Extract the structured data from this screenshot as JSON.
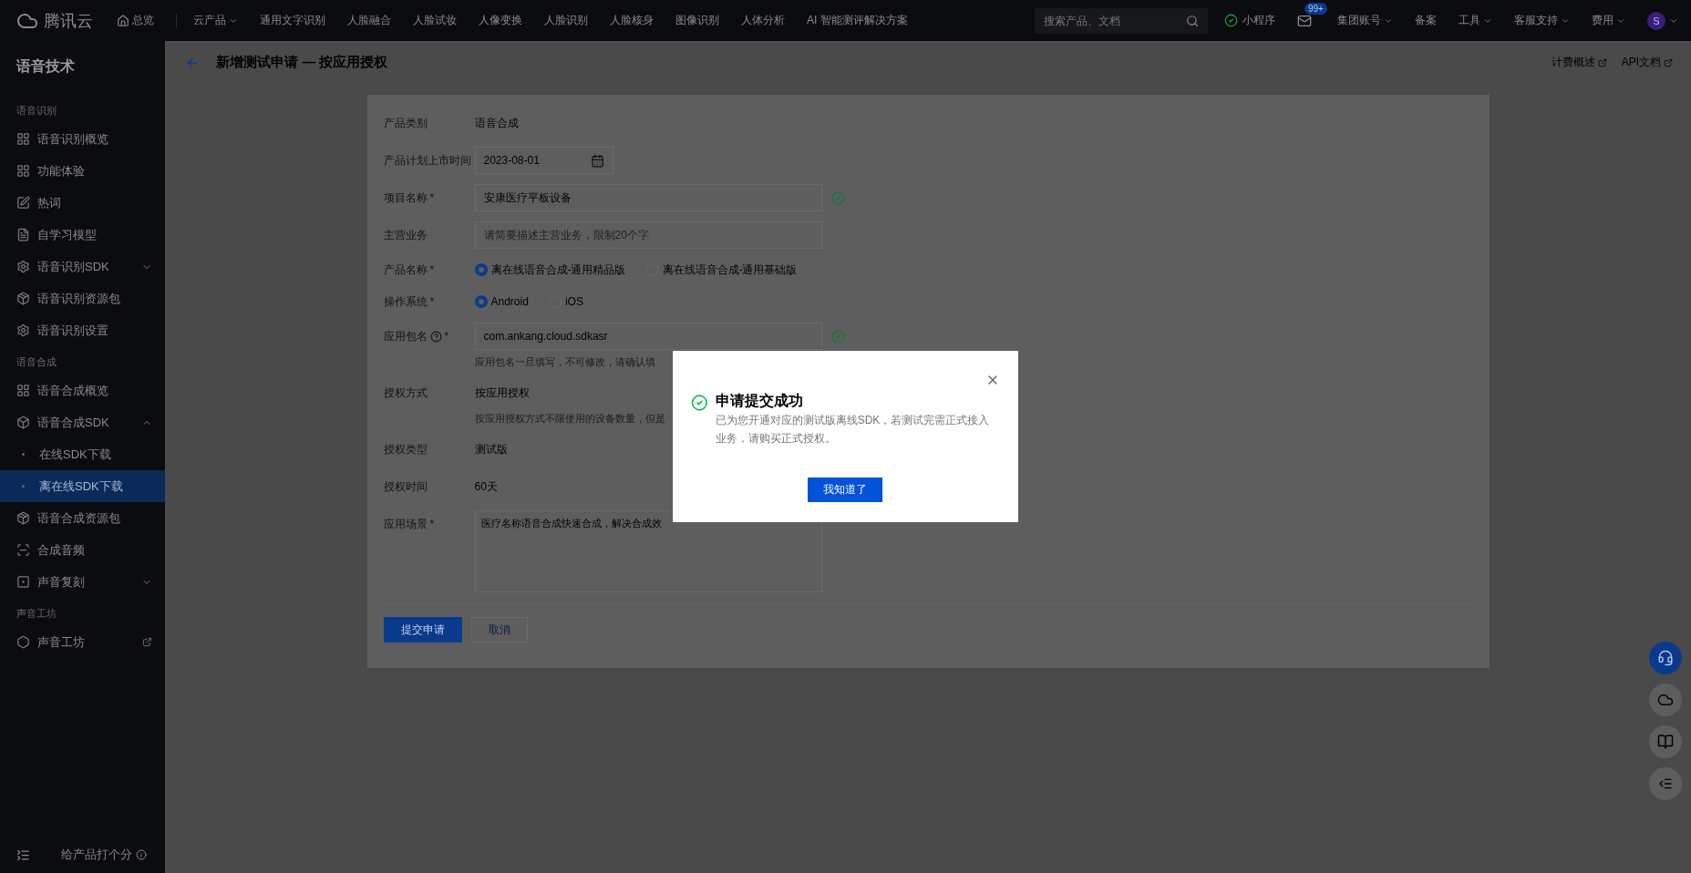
{
  "topbar": {
    "logo": "腾讯云",
    "home": "总览",
    "nav": [
      {
        "label": "云产品",
        "dropdown": true
      },
      {
        "label": "通用文字识别",
        "dropdown": false
      },
      {
        "label": "人脸融合",
        "dropdown": false
      },
      {
        "label": "人脸试妆",
        "dropdown": false
      },
      {
        "label": "人像变换",
        "dropdown": false
      },
      {
        "label": "人脸识别",
        "dropdown": false
      },
      {
        "label": "人脸核身",
        "dropdown": false
      },
      {
        "label": "图像识别",
        "dropdown": false
      },
      {
        "label": "人体分析",
        "dropdown": false
      },
      {
        "label": "AI 智能测评解决方案",
        "dropdown": false
      }
    ],
    "search": {
      "placeholder": "搜索产品、文档"
    },
    "miniapp": "小程序",
    "mail_badge": "99+",
    "right": [
      {
        "label": "集团账号",
        "dropdown": true
      },
      {
        "label": "备案",
        "dropdown": false
      },
      {
        "label": "工具",
        "dropdown": true
      },
      {
        "label": "客服支持",
        "dropdown": true
      },
      {
        "label": "费用",
        "dropdown": true
      }
    ],
    "avatar": "S"
  },
  "sidebar": {
    "title": "语音技术",
    "groups": [
      {
        "label": "语音识别",
        "items": [
          {
            "label": "语音识别概览",
            "selected": false
          },
          {
            "label": "功能体验",
            "selected": false
          },
          {
            "label": "热词",
            "selected": false
          },
          {
            "label": "自学习模型",
            "selected": false
          },
          {
            "label": "语音识别SDK",
            "selected": false,
            "expanded": false
          },
          {
            "label": "语音识别资源包",
            "selected": false
          },
          {
            "label": "语音识别设置",
            "selected": false
          }
        ]
      },
      {
        "label": "语音合成",
        "items": [
          {
            "label": "语音合成概览",
            "selected": false
          },
          {
            "label": "语音合成SDK",
            "selected": false,
            "expanded": true,
            "children": [
              {
                "label": "在线SDK下载",
                "selected": false
              },
              {
                "label": "离在线SDK下载",
                "selected": true
              }
            ]
          },
          {
            "label": "语音合成资源包",
            "selected": false
          },
          {
            "label": "合成音频",
            "selected": false
          },
          {
            "label": "声音复刻",
            "selected": false,
            "expanded": false
          }
        ]
      },
      {
        "label": "声音工坊",
        "items": [
          {
            "label": "声音工坊",
            "selected": false,
            "external": true
          }
        ]
      }
    ],
    "footer": "给产品打个分"
  },
  "header": {
    "title": "新增测试申请 — 按应用授权",
    "links": [
      "计费概述",
      "API文档"
    ]
  },
  "form": {
    "rows": [
      {
        "kind": "text",
        "label": "产品类别",
        "value": "语音合成"
      },
      {
        "kind": "date",
        "label": "产品计划上市时间",
        "value": "2023-08-01"
      },
      {
        "kind": "input",
        "label": "项目名称",
        "required_mark": "*",
        "value": "安康医疗平板设备",
        "valid": true
      },
      {
        "kind": "input",
        "label": "主营业务",
        "placeholder": "请简要描述主营业务，限制20个字",
        "valid": false
      },
      {
        "kind": "radio",
        "label": "产品名称",
        "required_mark": "*",
        "options": [
          {
            "label": "离在线语音合成-通用精品版",
            "selected": true
          },
          {
            "label": "离在线语音合成-通用基础版",
            "selected": false
          }
        ]
      },
      {
        "kind": "radio",
        "label": "操作系统",
        "required_mark": "*",
        "options": [
          {
            "label": "Android",
            "selected": true
          },
          {
            "label": "iOS",
            "selected": false
          }
        ]
      },
      {
        "kind": "input",
        "label": "应用包名",
        "help": true,
        "required_mark": "*",
        "value": "com.ankang.cloud.sdkasr",
        "valid": true,
        "hint": "应用包名一旦填写，不可修改，请确认填"
      },
      {
        "kind": "text",
        "label": "授权方式",
        "value": "按应用授权",
        "hint": "按应用授权方式不限使用的设备数量，但是"
      },
      {
        "kind": "text",
        "label": "授权类型",
        "value": "测试版"
      },
      {
        "kind": "text",
        "label": "授权时间",
        "value": "60天"
      },
      {
        "kind": "textarea",
        "label": "应用场景",
        "required_mark": "*",
        "value": "医疗名称语音合成快速合成，解决合成效"
      }
    ],
    "buttons": [
      {
        "label": "提交申请",
        "kind": "primary"
      },
      {
        "label": "取消",
        "kind": "secondary"
      }
    ]
  },
  "dialog": {
    "title": "申请提交成功",
    "message": "已为您开通对应的测试版离线SDK，若测试完需正式接入业务，请购买正式授权。",
    "button": "我知道了"
  }
}
